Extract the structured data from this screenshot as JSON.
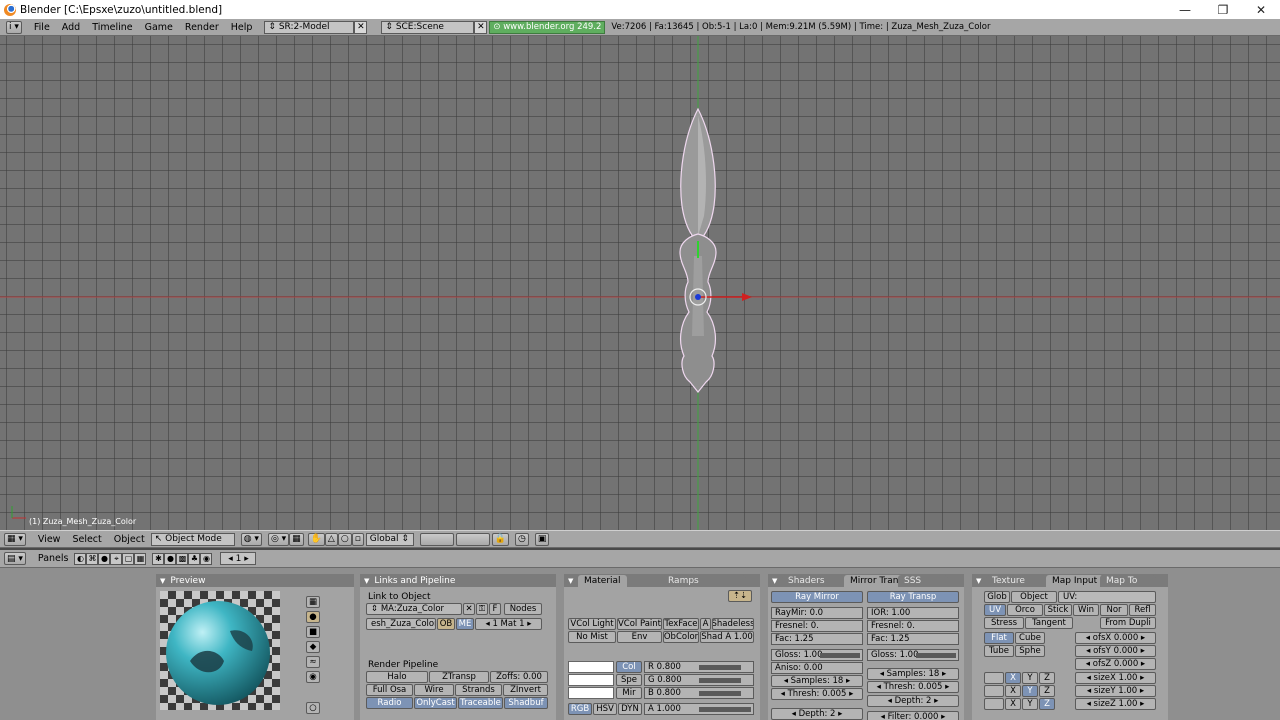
{
  "window": {
    "title": "Blender [C:\\Epsxe\\zuzo\\untitled.blend]",
    "controls": [
      "—",
      "❐",
      "✕"
    ]
  },
  "info_header": {
    "menus": [
      "File",
      "Add",
      "Timeline",
      "Game",
      "Render",
      "Help"
    ],
    "screen": "SR:2-Model",
    "scene": "SCE:Scene",
    "url": "www.blender.org 249.2",
    "stats": "Ve:7206 | Fa:13645 | Ob:5-1 | La:0  | Mem:9.21M (5.59M) | Time: | Zuza_Mesh_Zuza_Color"
  },
  "viewport": {
    "object_label": "(1) Zuza_Mesh_Zuza_Color",
    "grid_color": "#3c3c3c",
    "bg_color": "#737373"
  },
  "view_header": {
    "menus": [
      "View",
      "Select",
      "Object"
    ],
    "mode": "Object Mode",
    "orientation": "Global"
  },
  "buttons_header": {
    "panels_label": "Panels",
    "frame": "1"
  },
  "preview": {
    "title": "Preview"
  },
  "links": {
    "title": "Links and Pipeline",
    "link_to_object": "Link to Object",
    "material": "MA:Zuza_Color",
    "f_label": "F",
    "nodes_label": "Nodes",
    "mesh": "esh_Zuza_Color",
    "ob_label": "OB",
    "me_label": "ME",
    "mat_index": "1 Mat 1",
    "render_pipeline": "Render Pipeline",
    "halo": "Halo",
    "ztransp": "ZTransp",
    "zoffs": "Zoffs: 0.00",
    "full_osa": "Full Osa",
    "wire": "Wire",
    "strands": "Strands",
    "zinvert": "ZInvert",
    "radio": "Radio",
    "onlycast": "OnlyCast",
    "traceable": "Traceable",
    "shadbuf": "Shadbuf"
  },
  "material": {
    "tab_material": "Material",
    "tab_ramps": "Ramps",
    "vcol_light": "VCol Light",
    "vcol_paint": "VCol Paint",
    "texface": "TexFace",
    "a_label": "A",
    "shadeless": "Shadeless",
    "no_mist": "No Mist",
    "env": "Env",
    "obcolor": "ObColor",
    "shad_a": "Shad A 1.00",
    "col": "Col",
    "spe": "Spe",
    "mir": "Mir",
    "r": "R 0.800",
    "g": "G 0.800",
    "b": "B 0.800",
    "rgb": "RGB",
    "hsv": "HSV",
    "dyn": "DYN",
    "alpha": "A 1.000"
  },
  "shaders": {
    "tab_shaders": "Shaders",
    "tab_mirror": "Mirror Transp",
    "tab_sss": "SSS",
    "ray_mirror": "Ray Mirror",
    "ray_transp": "Ray Transp",
    "raymir": "RayMir: 0.0",
    "ior": "IOR: 1.00",
    "fresnel_l": "Fresnel: 0.",
    "fresnel_r": "Fresnel: 0.",
    "fac_l": "Fac: 1.25",
    "fac_r": "Fac: 1.25",
    "gloss_l": "Gloss: 1.00",
    "gloss_r": "Gloss: 1.00",
    "aniso": "Aniso: 0.00",
    "samples_l": "Samples: 18",
    "samples_r": "Samples: 18",
    "thresh_l": "Thresh: 0.005",
    "thresh_r": "Thresh: 0.005",
    "depth_l": "Depth: 2",
    "depth_r": "Depth: 2",
    "filter": "Filter: 0.000"
  },
  "texture": {
    "tab_texture": "Texture",
    "tab_map_input": "Map Input",
    "tab_map_to": "Map To",
    "glob": "Glob",
    "object": "Object",
    "uv_label": "UV:",
    "uv": "UV",
    "orco": "Orco",
    "stick": "Stick",
    "win": "Win",
    "nor": "Nor",
    "refl": "Refl",
    "stress": "Stress",
    "tangent": "Tangent",
    "from_dupli": "From Dupli",
    "flat": "Flat",
    "cube": "Cube",
    "tube": "Tube",
    "sphe": "Sphe",
    "ofsx": "ofsX 0.000",
    "ofsy": "ofsY 0.000",
    "ofsz": "ofsZ 0.000",
    "sizex": "sizeX 1.00",
    "sizey": "sizeY 1.00",
    "sizez": "sizeZ 1.00",
    "x": "X",
    "y": "Y",
    "z": "Z"
  }
}
